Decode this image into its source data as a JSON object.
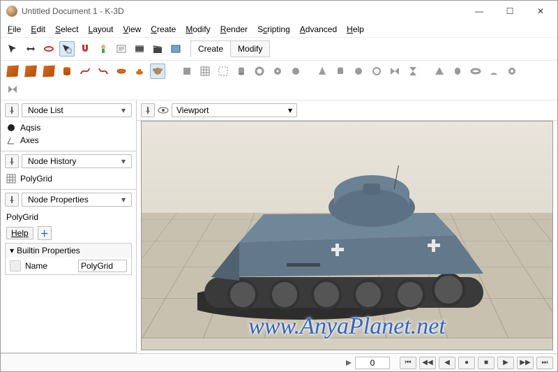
{
  "window": {
    "title": "Untitled Document 1 - K-3D",
    "controls": {
      "min": "—",
      "max": "☐",
      "close": "✕"
    }
  },
  "menubar": [
    "File",
    "Edit",
    "Select",
    "Layout",
    "View",
    "Create",
    "Modify",
    "Render",
    "Scripting",
    "Advanced",
    "Help"
  ],
  "toolbar1": {
    "tools": [
      "pointer",
      "align",
      "torus",
      "select-box",
      "magnet",
      "gizmo",
      "script",
      "film",
      "clapper",
      "render"
    ],
    "tabs": [
      "Create",
      "Modify"
    ],
    "active_tab": "Create"
  },
  "toolbar2": {
    "primitives_left": [
      "cube",
      "cube",
      "cube",
      "cylinder",
      "curve",
      "curve2",
      "torus",
      "teapot",
      "monkey"
    ],
    "primitives_right": [
      "cube-g",
      "grid",
      "select",
      "cylinder-g",
      "ring",
      "disc",
      "circle",
      "cone",
      "cylinder2",
      "sphere",
      "ring2",
      "bowtie",
      "hourglass",
      "sep",
      "pyramid",
      "pill",
      "torus-g",
      "arc",
      "donut",
      "halfmoon",
      "bowtie2"
    ]
  },
  "sidebar": {
    "panels": [
      {
        "title": "Node List",
        "items": [
          {
            "icon": "sphere-black",
            "label": "Aqsis"
          },
          {
            "icon": "axes",
            "label": "Axes"
          }
        ]
      },
      {
        "title": "Node History",
        "items": [
          {
            "icon": "grid",
            "label": "PolyGrid"
          }
        ]
      },
      {
        "title": "Node Properties",
        "label": "PolyGrid",
        "help_label": "Help",
        "section": "Builtin Properties",
        "rows": [
          {
            "name": "Name",
            "value": "PolyGrid"
          }
        ]
      }
    ]
  },
  "viewport": {
    "title": "Viewport",
    "watermark": "www.AnyaPlanet.net"
  },
  "statusbar": {
    "frame_value": "0",
    "nav": [
      "⏮",
      "◀◀",
      "◀",
      "●",
      "■",
      "▶",
      "▶▶",
      "⏭"
    ]
  }
}
